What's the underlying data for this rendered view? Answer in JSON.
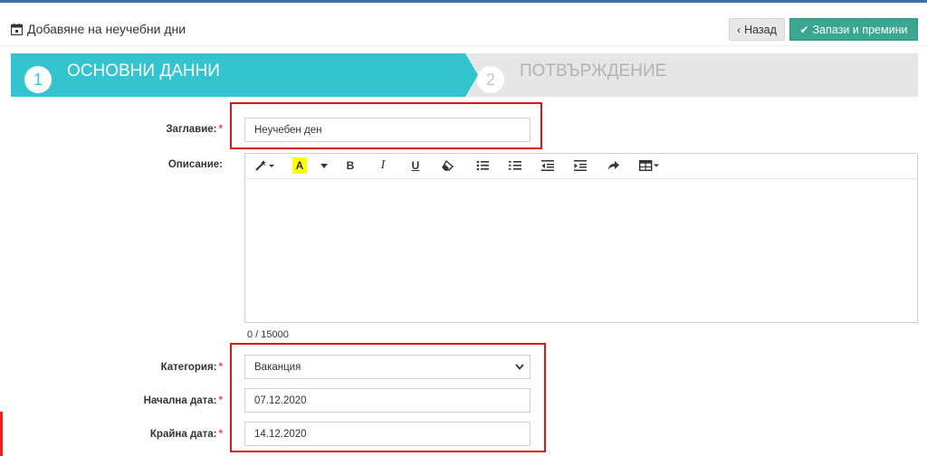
{
  "header": {
    "title": "Добавяне на неучебни дни",
    "icon": "calendar-icon"
  },
  "buttons": {
    "back": "Назад",
    "save": "Запази и премини"
  },
  "steps": [
    {
      "number": "1",
      "label": "ОСНОВНИ ДАННИ"
    },
    {
      "number": "2",
      "label": "ПОТВЪРЖДЕНИЕ"
    }
  ],
  "form": {
    "title_label": "Заглавие:",
    "title_value": "Неучебен ден",
    "description_label": "Описание:",
    "counter": "0 / 15000",
    "category_label": "Категория:",
    "category_value": "Ваканция",
    "start_label": "Начална дата:",
    "start_value": "07.12.2020",
    "end_label": "Крайна дата:",
    "end_value": "14.12.2020",
    "required_mark": "*"
  },
  "colors": {
    "accent": "#33c5cf",
    "save": "#3aa891",
    "highlight": "#e0141b"
  }
}
